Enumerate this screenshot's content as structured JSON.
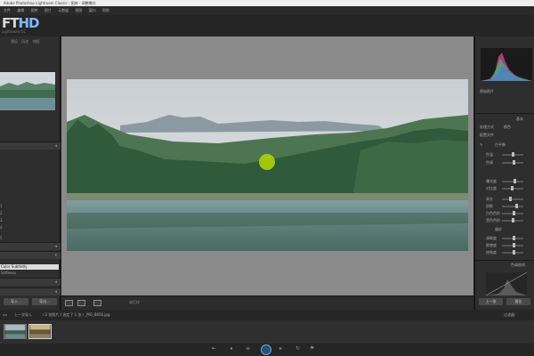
{
  "app": {
    "window_title": "Adobe Photoshop Lightroom Classic - 图库 - 调整曝光",
    "logo_prefix": "FT",
    "logo_suffix": "HD",
    "product_name": "Lightroom CC"
  },
  "menu": [
    "文件",
    "编辑",
    "图库",
    "照片",
    "元数据",
    "视图",
    "窗口",
    "帮助"
  ],
  "left_panel": {
    "tabs": [
      "预设",
      "历史",
      "快照"
    ],
    "marks": [
      "1",
      "2",
      "3",
      "4",
      "5"
    ],
    "highlight_row": "Color Subtletly",
    "row_after": "Softness",
    "buttons": [
      "导入...",
      "导出..."
    ]
  },
  "toolbar": {
    "label": "软打样"
  },
  "right_panel": {
    "header_label": "原始照片",
    "section_basic": "基本",
    "treatment_label": "处理方式",
    "treatment_value": "颜色",
    "profile_label": "配置文件",
    "wb_label": "白平衡",
    "rows": [
      "色温",
      "色调",
      "曝光度",
      "对比度",
      "高光",
      "阴影",
      "白色色阶",
      "黑色色阶",
      "清晰度",
      "鲜艳度",
      "饱和度"
    ],
    "presence_label": "偏好",
    "tone_curve_label": "色调曲线",
    "buttons": [
      "上一张",
      "复位"
    ]
  },
  "filmstrip_bar": {
    "nav": "上一次导入",
    "path": "/ 2 张照片 / 选定了 1 张 / _MG_8856.jpg",
    "filter": "过滤器:"
  },
  "colors": {
    "accent": "#6aa8e0",
    "cursor": "#b5d800"
  }
}
